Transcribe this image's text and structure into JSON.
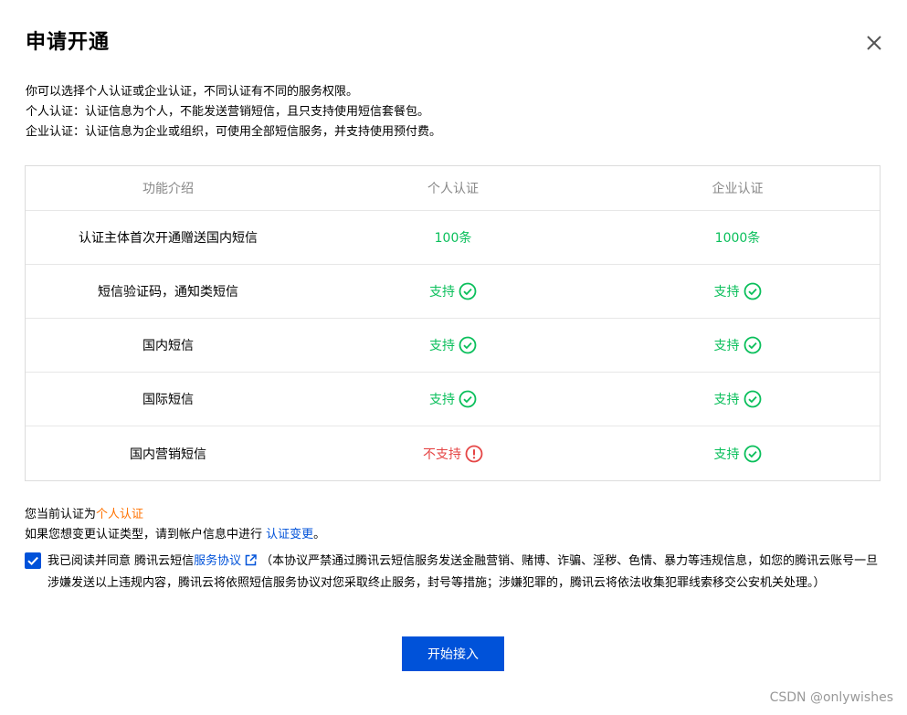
{
  "dialog": {
    "title": "申请开通",
    "close_icon": "close-icon"
  },
  "intro": {
    "line1": "你可以选择个人认证或企业认证，不同认证有不同的服务权限。",
    "line2": "个人认证：认证信息为个人，不能发送营销短信，且只支持使用短信套餐包。",
    "line3": "企业认证：认证信息为企业或组织，可使用全部短信服务，并支持使用预付费。"
  },
  "table": {
    "headers": [
      "功能介绍",
      "个人认证",
      "企业认证"
    ],
    "rows": [
      {
        "feature": "认证主体首次开通赠送国内短信",
        "personal": "100条",
        "enterprise": "1000条"
      },
      {
        "feature": "短信验证码，通知类短信",
        "personal": "支持",
        "enterprise": "支持"
      },
      {
        "feature": "国内短信",
        "personal": "支持",
        "enterprise": "支持"
      },
      {
        "feature": "国际短信",
        "personal": "支持",
        "enterprise": "支持"
      },
      {
        "feature": "国内营销短信",
        "personal": "不支持",
        "enterprise": "支持"
      }
    ]
  },
  "current": {
    "prefix": "您当前认证为",
    "value": "个人认证",
    "change_prefix": "如果您想变更认证类型，请到帐户信息中进行 ",
    "change_link": "认证变更",
    "change_suffix": "。"
  },
  "agreement": {
    "checked": true,
    "prefix": "我已阅读并同意 腾讯云短信",
    "link": "服务协议",
    "body": "（本协议严禁通过腾讯云短信服务发送金融营销、赌博、诈骗、淫秽、色情、暴力等违规信息，如您的腾讯云账号一旦涉嫌发送以上违规内容，腾讯云将依照短信服务协议对您采取终止服务，封号等措施；涉嫌犯罪的，腾讯云将依法收集犯罪线索移交公安机关处理。）"
  },
  "button": {
    "label": "开始接入"
  },
  "watermark": "CSDN @onlywishes",
  "colors": {
    "accent": "#0052d9",
    "success": "#0abf5b",
    "error": "#e54545",
    "highlight": "#ff7200"
  }
}
